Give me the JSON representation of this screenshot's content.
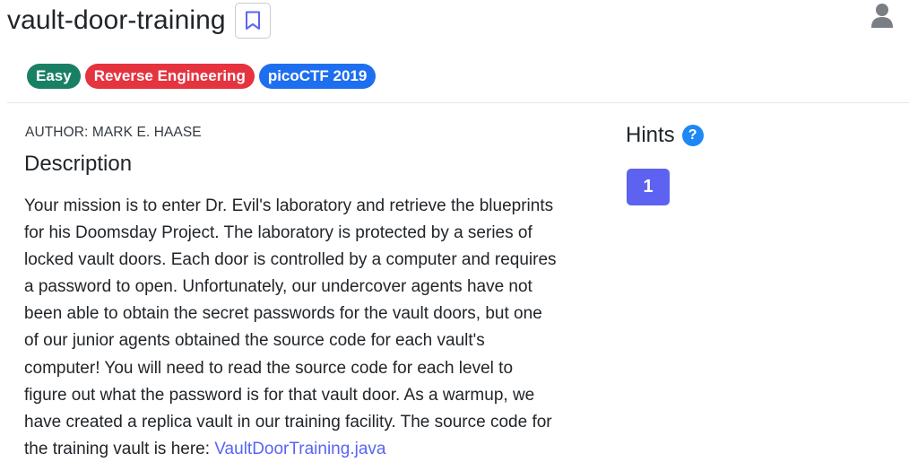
{
  "challenge": {
    "title": "vault-door-training",
    "tags": [
      "Easy",
      "Reverse Engineering",
      "picoCTF 2019"
    ],
    "author": "AUTHOR: MARK E. HAASE",
    "description_heading": "Description",
    "description_lines": [
      "Your mission is to enter Dr. Evil's laboratory and retrieve the blueprints",
      "for his Doomsday Project. The laboratory is protected by a series of",
      "locked vault doors. Each door is controlled by a computer and requires",
      "a password to open. Unfortunately, our undercover agents have not",
      "been able to obtain the secret passwords for the vault doors, but one",
      "of our junior agents obtained the source code for each vault's",
      "computer! You will need to read the source code for each level to",
      "figure out what the password is for that vault door. As a warmup, we",
      "have created a replica vault in our training facility. The source code for"
    ],
    "description_last_line_prefix": "the training vault is here:",
    "source_link": "VaultDoorTraining.java"
  },
  "hints": {
    "heading": "Hints",
    "help_symbol": "?",
    "items": [
      "1"
    ]
  },
  "icons": {
    "bookmark": "bookmark-icon",
    "user": "user-icon",
    "help": "help-icon"
  },
  "colors": {
    "easy": "#198065",
    "category": "#e5333f",
    "event": "#1e6ff0",
    "hint_button": "#5d63f0",
    "link": "#5865f2"
  }
}
